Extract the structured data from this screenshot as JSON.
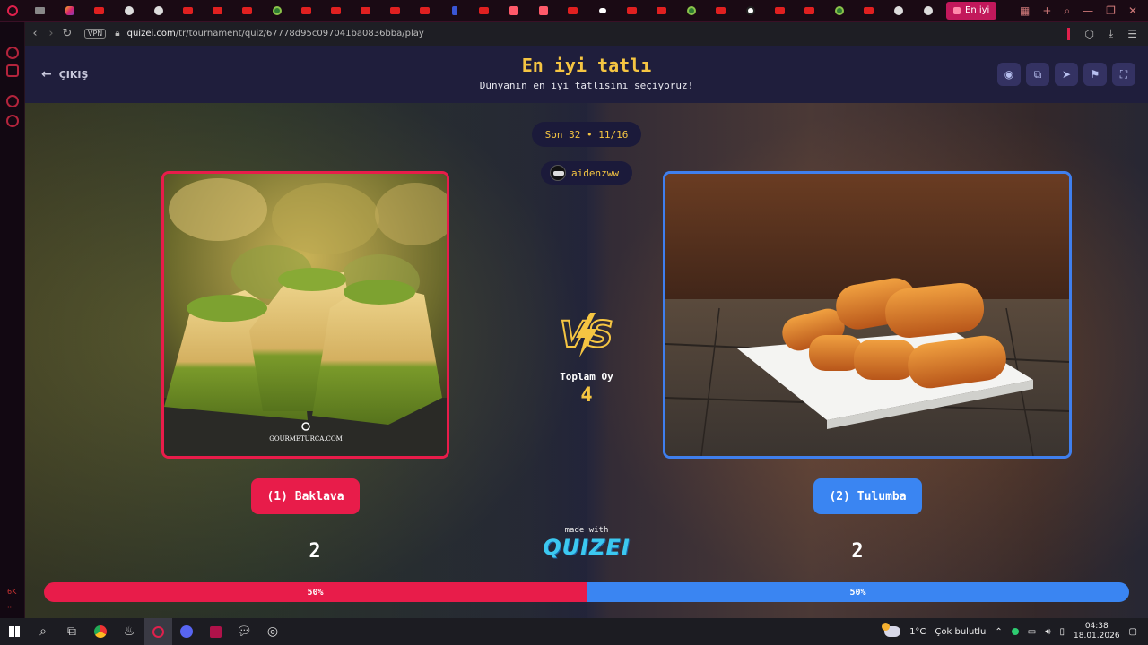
{
  "browser": {
    "active_tab_label": "En iyi",
    "url_domain": "quizei.com",
    "url_path": "/tr/tournament/quiz/67778d95c097041ba0836bba/play",
    "vpn_label": "VPN"
  },
  "header": {
    "exit_label": "ÇIKIŞ",
    "title": "En iyi tatlı",
    "subtitle": "Dünyanın en iyi tatlısını seçiyoruz!"
  },
  "round": {
    "label": "Son 32 • 11/16",
    "username": "aidenzww"
  },
  "left": {
    "watermark": "GOURMETURCA.COM",
    "button_label": "(1) Baklava",
    "votes": "2",
    "percent_label": "50%",
    "percent": 50
  },
  "right": {
    "button_label": "(2) Tulumba",
    "votes": "2",
    "percent_label": "50%",
    "percent": 50
  },
  "totals": {
    "label": "Toplam Oy",
    "value": "4"
  },
  "footer": {
    "made_with": "made with",
    "brand": "QUIZEI"
  },
  "sidebar": {
    "bottom_label": "6K"
  },
  "taskbar": {
    "weather_temp": "1°C",
    "weather_desc": "Çok bulutlu",
    "time": "04:38",
    "date": "18.01.2026"
  },
  "colors": {
    "accent_yellow": "#f5c542",
    "left_red": "#e81c4a",
    "right_blue": "#3a85f2",
    "header_bg": "#1f1e3c"
  }
}
